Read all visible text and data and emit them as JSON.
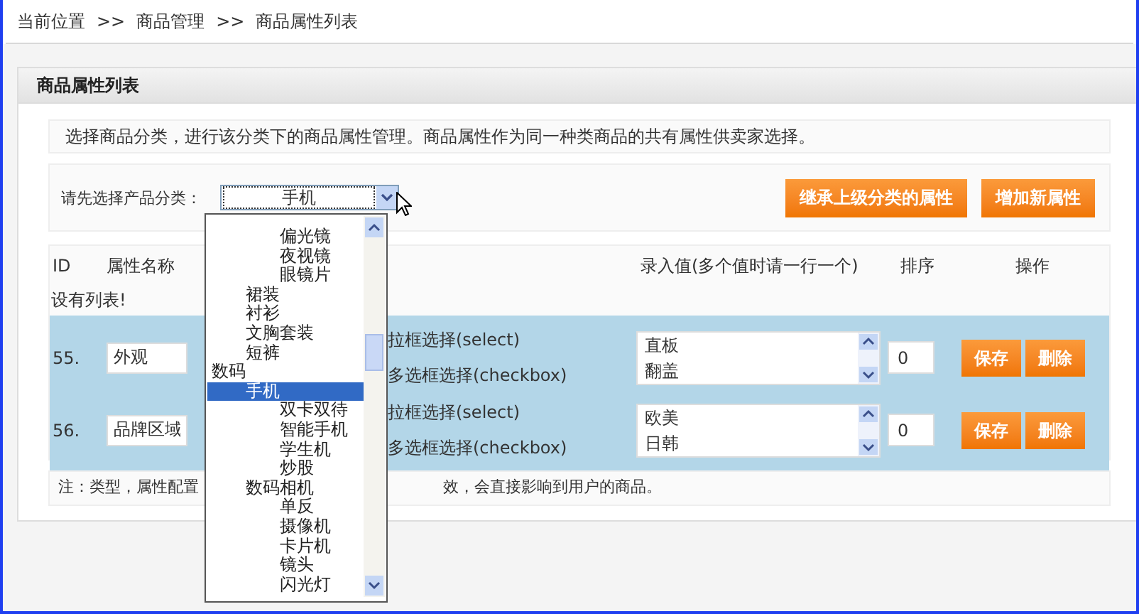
{
  "breadcrumb": [
    "当前位置",
    ">>",
    "商品管理",
    ">>",
    "商品属性列表"
  ],
  "panel": {
    "title": "商品属性列表",
    "intro": "选择商品分类，进行该分类下的商品属性管理。商品属性作为同一种类商品的共有属性供卖家选择。",
    "category_label": "请先选择产品分类：",
    "category_select": {
      "value": "手机",
      "expanded": true
    },
    "buttons": [
      "继承上级分类的属性",
      "增加新属性"
    ],
    "columns": [
      "ID",
      "属性名称",
      "录入值(多个值时请一行一个)",
      "排序",
      "操作"
    ],
    "empty_message": "设有列表!",
    "rows": [
      {
        "id": "55.",
        "name": "外观",
        "types": [
          "拉框选择(select)",
          "多选框选择(checkbox)"
        ],
        "values": [
          "直板",
          "翻盖"
        ],
        "sort": "0",
        "actions": [
          "保存",
          "删除"
        ]
      },
      {
        "id": "56.",
        "name": "品牌区域",
        "types": [
          "拉框选择(select)",
          "多选框选择(checkbox)"
        ],
        "values": [
          "欧美",
          "日韩"
        ],
        "sort": "0",
        "actions": [
          "保存",
          "删除"
        ]
      }
    ],
    "note_parts": [
      "注：类型，属性配置",
      "效，会直接影响到用户的商品。"
    ]
  },
  "dropdown": {
    "options": [
      {
        "children": [
          {
            "children": [
              {
                "label": "偏光镜",
                "selected": false
              },
              {
                "label": "夜视镜",
                "selected": false
              },
              {
                "label": "眼镜片",
                "selected": false
              }
            ]
          },
          {
            "label": "裙装",
            "selected": false
          },
          {
            "label": "衬衫",
            "selected": false
          },
          {
            "label": "文胸套装",
            "selected": false
          },
          {
            "label": "短裤",
            "selected": false
          }
        ]
      },
      {
        "label": "数码",
        "selected": false,
        "children": [
          {
            "label": "手机",
            "selected": true,
            "children": [
              {
                "label": "双卡双待",
                "selected": false
              },
              {
                "label": "智能手机",
                "selected": false
              },
              {
                "label": "学生机",
                "selected": false
              },
              {
                "label": "炒股",
                "selected": false
              }
            ]
          },
          {
            "label": "数码相机",
            "selected": false,
            "children": [
              {
                "label": "单反",
                "selected": false
              },
              {
                "label": "摄像机",
                "selected": false
              },
              {
                "label": "卡片机",
                "selected": false
              },
              {
                "label": "镜头",
                "selected": false
              },
              {
                "label": "闪光灯",
                "selected": false
              }
            ]
          }
        ]
      }
    ]
  }
}
